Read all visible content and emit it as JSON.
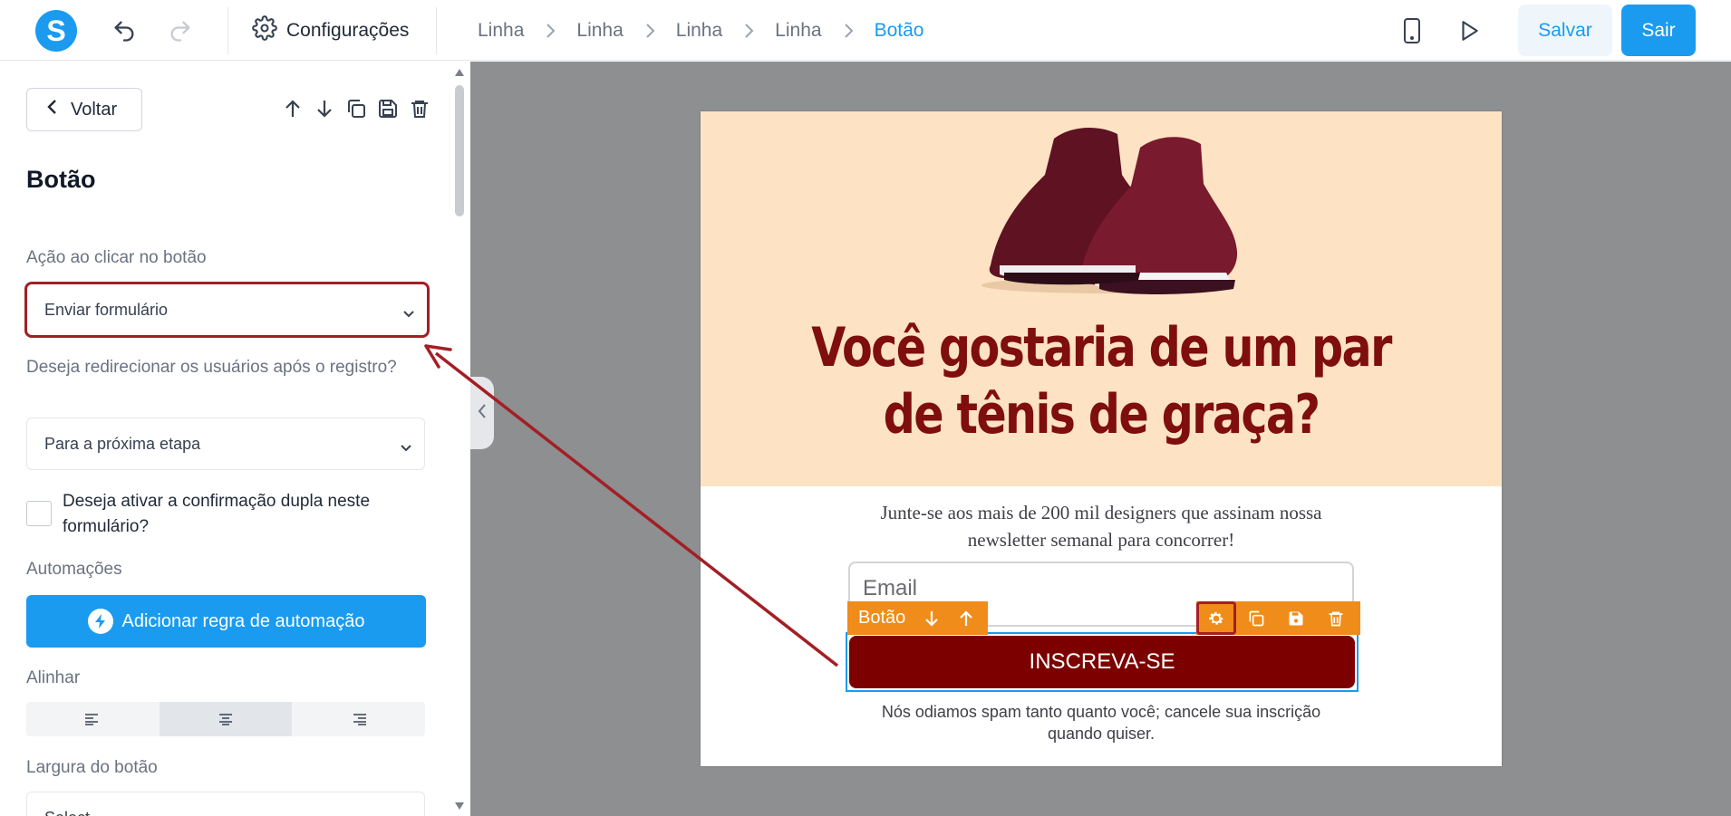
{
  "topbar": {
    "logo_letter": "S",
    "undo_icon": "undo-icon",
    "redo_icon": "redo-icon",
    "settings_label": "Configurações",
    "breadcrumbs": [
      "Linha",
      "Linha",
      "Linha",
      "Linha",
      "Botão"
    ],
    "mobile_preview_icon": "smartphone-icon",
    "play_icon": "play-icon",
    "save_label": "Salvar",
    "exit_label": "Sair"
  },
  "panel": {
    "back_label": "Voltar",
    "title": "Botão",
    "action_label": "Ação ao clicar no botão",
    "action_value": "Enviar formulário",
    "redirect_label": "Deseja redirecionar os usuários após o registro?",
    "redirect_value": "Para a próxima etapa",
    "double_optin_label": "Deseja ativar a confirmação dupla neste formulário?",
    "double_optin_checked": false,
    "automations_label": "Automações",
    "add_automation_label": "Adicionar regra de automação",
    "align_label": "Alinhar",
    "align_selected": "center",
    "width_label": "Largura do botão",
    "width_value": "Select"
  },
  "canvas": {
    "headline": "Você gostaria de um par de tênis de graça?",
    "subtext": "Junte-se aos mais de 200 mil designers que assinam nossa newsletter semanal para concorrer!",
    "email_placeholder": "Email",
    "cta_label": "INSCREVA-SE",
    "element_toolbar_label": "Botão",
    "footer_text": "Nós odiamos spam tanto quanto você; cancele sua inscrição quando quiser."
  },
  "colors": {
    "accent": "#1a9bf0",
    "highlight": "#a31f24",
    "hero_bg": "#fde3c4",
    "headline": "#7f0e0e",
    "cta_bg": "#7c0000",
    "toolbar": "#f08c1a"
  }
}
